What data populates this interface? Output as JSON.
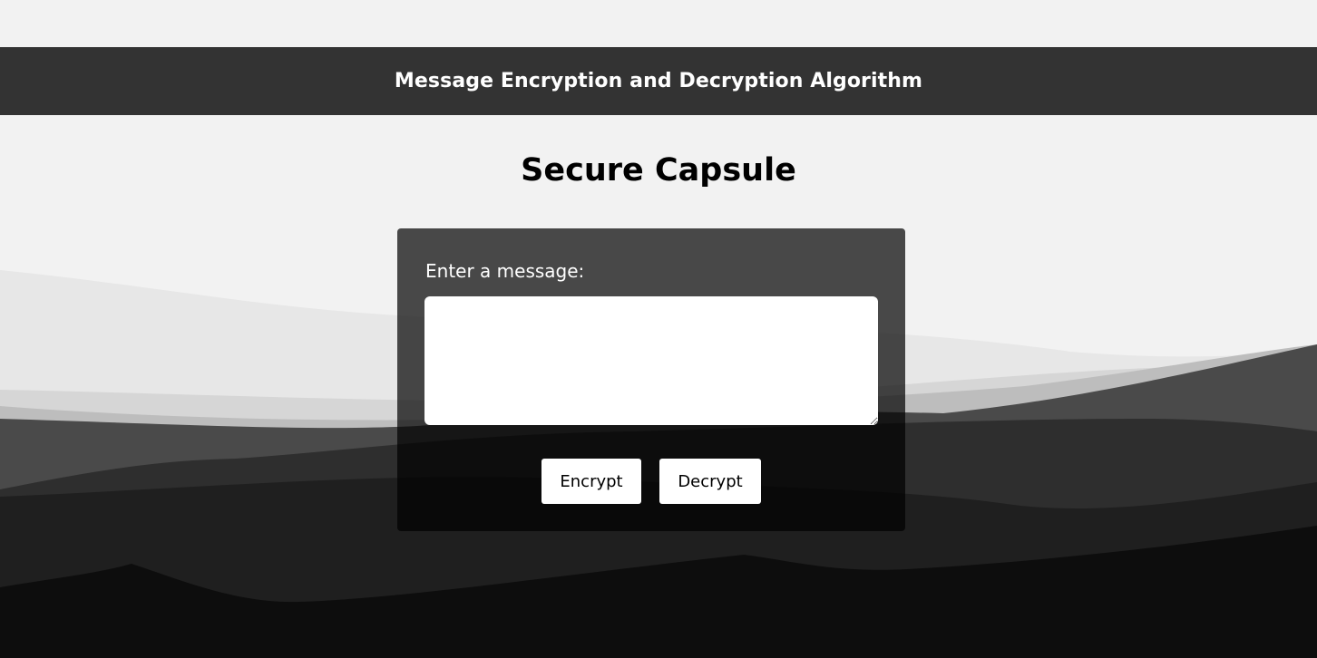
{
  "header": {
    "title": "Message Encryption and Decryption Algorithm"
  },
  "main": {
    "title": "Secure Capsule"
  },
  "form": {
    "message_label": "Enter a message:",
    "message_value": "",
    "encrypt_label": "Encrypt",
    "decrypt_label": "Decrypt"
  },
  "colors": {
    "header_bg": "#333333",
    "page_bg": "#f2f2f2",
    "button_bg": "#ffffff"
  }
}
